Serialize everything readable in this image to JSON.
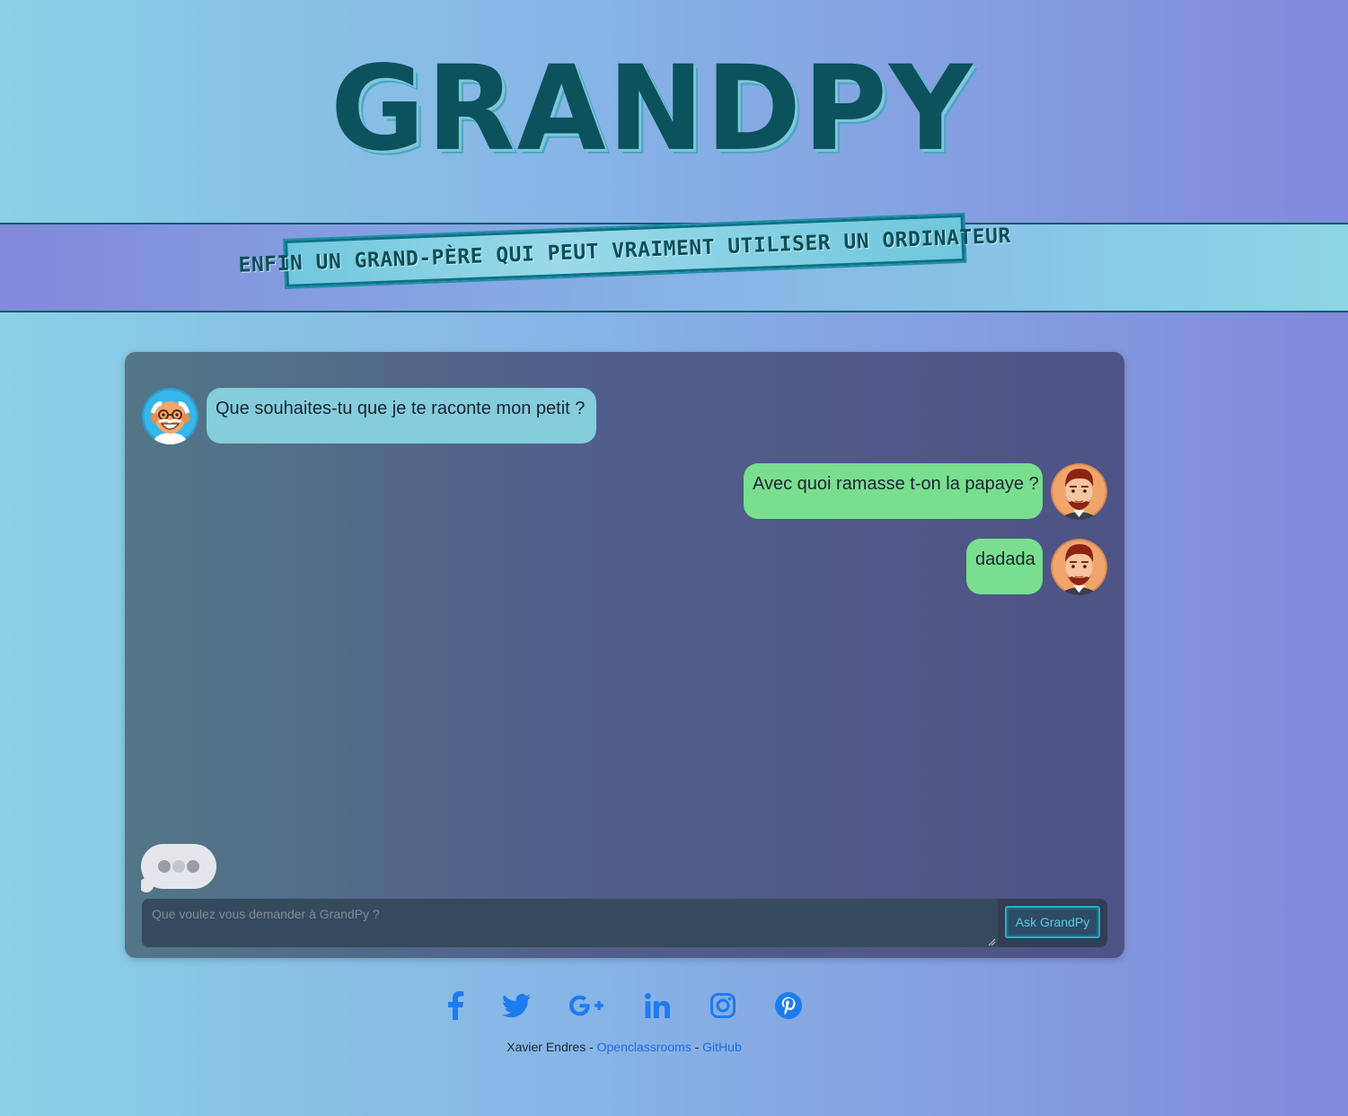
{
  "header": {
    "title": "GRANDPY",
    "tagline": "ENFIN UN GRAND-PÈRE QUI PEUT VRAIMENT UTILISER UN ORDINATEUR"
  },
  "chat": {
    "messages": [
      {
        "sender": "grandpy",
        "text": "Que souhaites-tu que je te raconte mon petit ?"
      },
      {
        "sender": "user",
        "text": "Avec quoi ramasse t-on la papaye ?"
      },
      {
        "sender": "user",
        "text": "dadada"
      }
    ],
    "input_placeholder": "Que voulez vous demander à GrandPy ?",
    "input_value": "",
    "send_label": "Ask GrandPy"
  },
  "footer": {
    "social_icons": [
      "facebook-icon",
      "twitter-icon",
      "google-plus-icon",
      "linkedin-icon",
      "instagram-icon",
      "pinterest-icon"
    ],
    "author": "Xavier Endres",
    "separator": "-",
    "links": [
      {
        "label": "Openclassrooms"
      },
      {
        "label": "GitHub"
      }
    ]
  },
  "colors": {
    "title": "#0c525d",
    "bot_bubble": "#84cddc",
    "user_bubble": "#79df8f",
    "social_icon": "#1d7bf0",
    "link": "#1d6fe0"
  }
}
